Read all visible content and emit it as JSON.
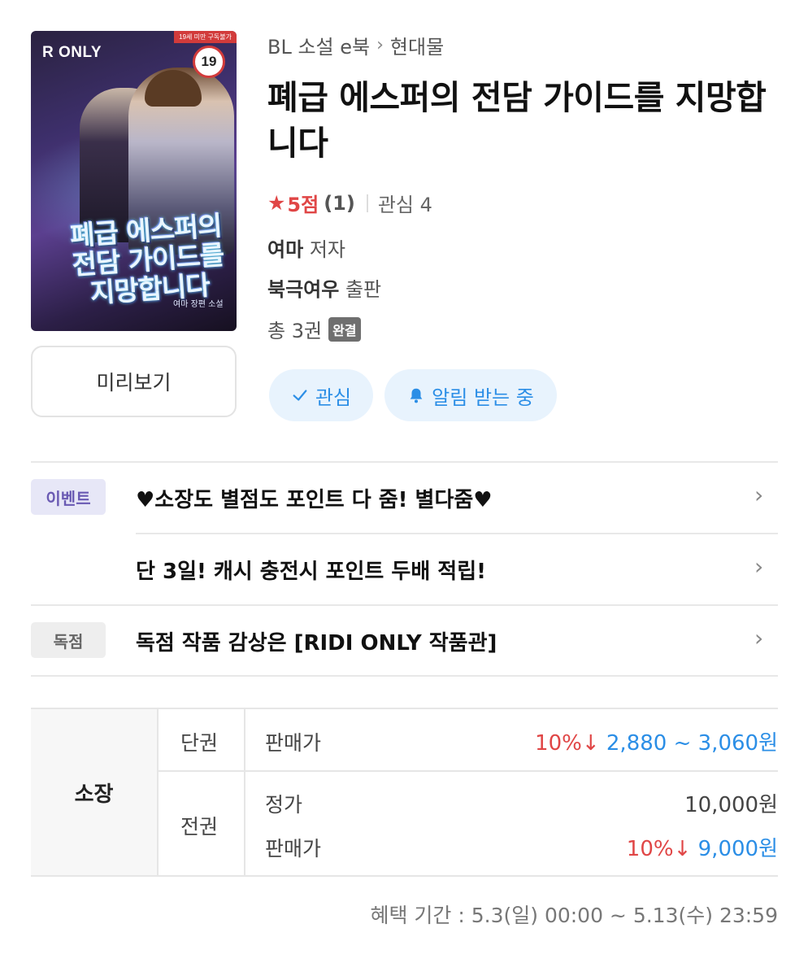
{
  "cover": {
    "label": "R ONLY",
    "age_notice": "19세 미만 구독불가",
    "age_rating": "19",
    "cover_title": "폐급 에스퍼의 전담 가이드를 지망합니다",
    "cover_sub": "여마 장편 소설"
  },
  "preview_label": "미리보기",
  "breadcrumb": {
    "category": "BL 소설 e북",
    "subcategory": "현대물"
  },
  "title": "폐급 에스퍼의 전담 가이드를 지망합니다",
  "rating": {
    "score": "5점",
    "count": "(1)",
    "wishlist": "관심 4"
  },
  "author": {
    "name": "여마",
    "role": "저자"
  },
  "publisher": {
    "name": "북극여우",
    "role": "출판"
  },
  "volumes": {
    "text": "총 3권",
    "badge": "완결"
  },
  "actions": {
    "wish_label": "관심",
    "alarm_label": "알림 받는 중"
  },
  "events": [
    {
      "tag": "이벤트",
      "text": "♥소장도 별점도 포인트 다 줌! 별다줌♥"
    },
    {
      "tag": "",
      "text": "단 3일! 캐시 충전시 포인트 두배 적립!"
    },
    {
      "tag": "독점",
      "text": "독점 작품 감상은 [RIDI ONLY 작품관]"
    }
  ],
  "pricing": {
    "owner_label": "소장",
    "single": {
      "label": "단권",
      "sale_label": "판매가",
      "discount": "10%↓",
      "range": "2,880 ~ 3,060원"
    },
    "full": {
      "label": "전권",
      "regular_label": "정가",
      "regular_price": "10,000원",
      "sale_label": "판매가",
      "discount": "10%↓",
      "sale_price": "9,000원"
    }
  },
  "benefit_period": "혜택 기간 : 5.3(일) 00:00 ~ 5.13(수) 23:59",
  "colors": {
    "accent_blue": "#2b8ee6",
    "discount_red": "#e04646",
    "pill_bg": "#e8f3fd"
  }
}
